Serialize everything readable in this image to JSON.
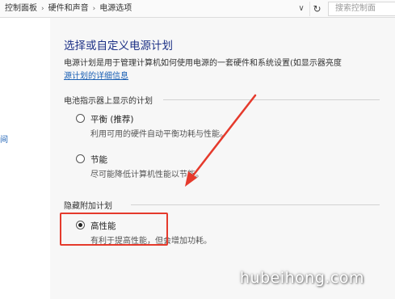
{
  "breadcrumb": {
    "items": [
      "控制面板",
      "硬件和声音",
      "电源选项"
    ],
    "separator": "›",
    "dropdown_glyph": "∨",
    "refresh_glyph": "↻"
  },
  "search": {
    "placeholder": "搜索控制面"
  },
  "left_pane": {
    "stub_text": "间"
  },
  "page": {
    "title": "选择或自定义电源计划",
    "description": "电源计划是用于管理计算机如何使用电源的一套硬件和系统设置(如显示器亮度",
    "link": "源计划的详细信息"
  },
  "battery_group": {
    "label": "电池指示器上显示的计划",
    "plans": [
      {
        "name": "平衡 (推荐)",
        "desc": "利用可用的硬件自动平衡功耗与性能。",
        "checked": false
      },
      {
        "name": "节能",
        "desc": "尽可能降低计算机性能以节能。",
        "checked": false
      }
    ]
  },
  "hidden_group": {
    "label": "隐藏附加计划",
    "plans": [
      {
        "name": "高性能",
        "desc": "有利于提高性能，但会增加功耗。",
        "checked": true
      }
    ]
  },
  "annotation": {
    "color": "#e53a2c"
  },
  "watermark": {
    "text": "hubeihong.com"
  },
  "colors": {
    "title": "#1e3287",
    "link": "#1a5fb4",
    "background": "#f7f7f7"
  }
}
